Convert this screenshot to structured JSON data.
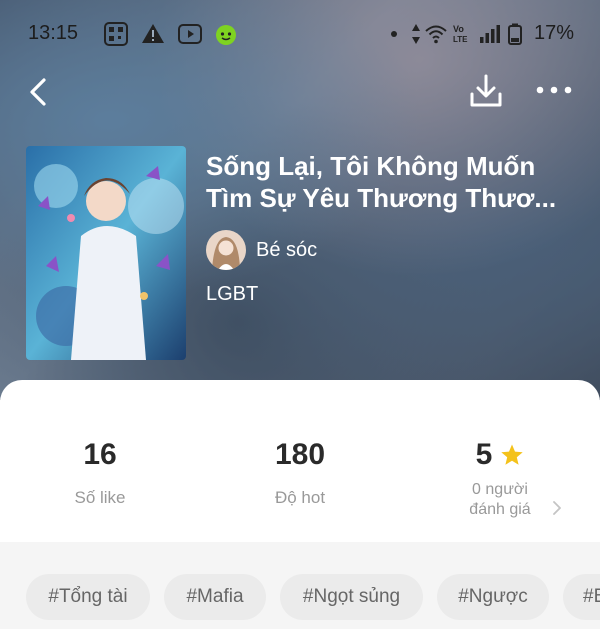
{
  "status_bar": {
    "time": "13:15",
    "battery": "17%",
    "left_icons": [
      "qr-icon",
      "warning-icon",
      "youtube-icon",
      "android-icon"
    ],
    "right_icons": [
      "dot-icon",
      "data-arrows-icon",
      "wifi-icon",
      "volte-icon",
      "signal-icon",
      "battery-icon"
    ]
  },
  "toolbar": {
    "back_icon": "chevron-left-icon",
    "download_icon": "download-icon",
    "more_icon": "more-horizontal-icon"
  },
  "book": {
    "title_line1": "Sống Lại, Tôi Không Muốn",
    "title_line2": "Tìm Sự Yêu Thương Thươ...",
    "author": "Bé sóc",
    "genre": "LGBT"
  },
  "stats": [
    {
      "value": "16",
      "label": "Số like"
    },
    {
      "value": "180",
      "label": "Độ hot"
    },
    {
      "value": "5",
      "label_line1": "0 người",
      "label_line2": "đánh giá"
    }
  ],
  "colors": {
    "star": "#f4c21b",
    "sheet": "#ffffff",
    "tag_bg": "#ebebeb"
  },
  "tags": [
    "#Tổng tài",
    "#Mafia",
    "#Ngọt sủng",
    "#Ngược",
    "#B"
  ]
}
